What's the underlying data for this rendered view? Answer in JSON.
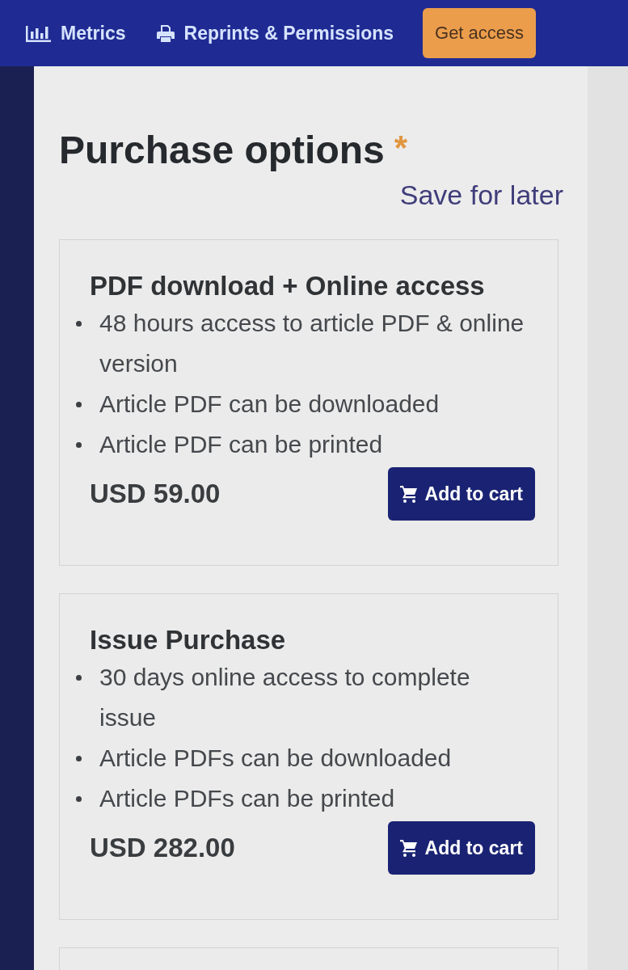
{
  "nav": {
    "links": [
      {
        "kind": "chart",
        "label": "Metrics"
      },
      {
        "kind": "printer",
        "label": "Reprints & Permissions"
      }
    ],
    "button": "Get access"
  },
  "purchase": {
    "title": "Purchase options",
    "required_mark": "*",
    "save_link": "Save for later",
    "options": [
      {
        "title": "PDF download + Online access",
        "features": [
          "48 hours access to article PDF & online version",
          "Article PDF can be downloaded",
          "Article PDF can be printed"
        ],
        "price": "USD 59.00",
        "button": "Add to cart"
      },
      {
        "title": "Issue Purchase",
        "features": [
          "30 days online access to complete issue",
          "Article PDFs can be downloaded",
          "Article PDFs can be printed"
        ],
        "price": "USD 282.00",
        "button": "Add to cart"
      }
    ]
  }
}
